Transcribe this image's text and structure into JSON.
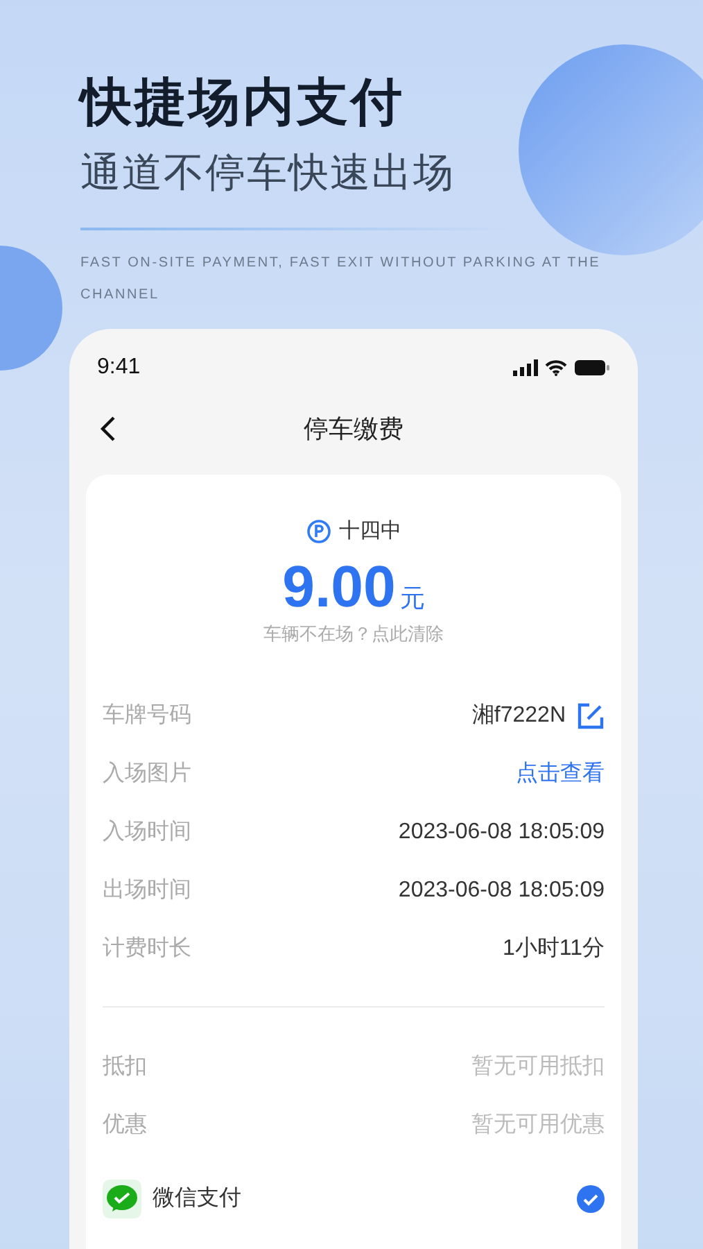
{
  "hero": {
    "title": "快捷场内支付",
    "subtitle": "通道不停车快速出场",
    "english": "FAST ON-SITE PAYMENT, FAST EXIT WITHOUT PARKING AT THE CHANNEL"
  },
  "status_bar": {
    "time": "9:41"
  },
  "nav": {
    "title": "停车缴费"
  },
  "summary": {
    "lot": "十四中",
    "amount": "9.00",
    "unit": "元",
    "hint": "车辆不在场？点此清除"
  },
  "details": [
    {
      "label": "车牌号码",
      "value": "湘f7222N",
      "kind": "editable"
    },
    {
      "label": "入场图片",
      "value": "点击查看",
      "kind": "link"
    },
    {
      "label": "入场时间",
      "value": "2023-06-08 18:05:09",
      "kind": "plain"
    },
    {
      "label": "出场时间",
      "value": "2023-06-08 18:05:09",
      "kind": "plain"
    },
    {
      "label": "计费时长",
      "value": "1小时11分",
      "kind": "plain"
    }
  ],
  "discounts": [
    {
      "label": "抵扣",
      "value": "暂无可用抵扣"
    },
    {
      "label": "优惠",
      "value": "暂无可用优惠"
    }
  ],
  "payment_methods": [
    {
      "label": "微信支付",
      "selected": true
    }
  ]
}
